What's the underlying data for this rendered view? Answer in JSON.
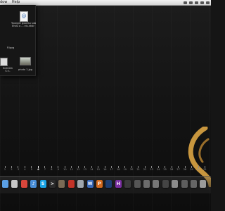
{
  "menubar": {
    "menus": [
      "dow",
      "Help"
    ],
    "status_icons": [
      "wifi-icon",
      "volume-icon",
      "battery-icon",
      "clock-icon",
      "search-icon"
    ]
  },
  "finder": {
    "items": [
      {
        "label_line1": "Younger gooesu sub",
        "label_line2": "Ehdu o ... eis.ntstr",
        "icon": "document-icon"
      },
      {
        "label": "Flipvg",
        "icon": "photo-icon"
      },
      {
        "label_line1": "ScenIdn",
        "label_line2": "S: t-",
        "icon": "photo-icon"
      },
      {
        "label": "photo 1.jpg",
        "icon": "photo-icon"
      }
    ]
  },
  "calendar_strip": {
    "days": [
      "1",
      "2",
      "3",
      "4",
      "5",
      "6",
      "7",
      "8",
      "9",
      "10",
      "11",
      "12",
      "13",
      "14",
      "15",
      "16",
      "17",
      "18",
      "19",
      "20",
      "21",
      "22",
      "23",
      "24",
      "25",
      "26",
      "27",
      "28",
      "29",
      "30",
      "31"
    ],
    "today": "6"
  },
  "dock": {
    "apps": [
      {
        "name": "finder-icon",
        "color": "#5aa0e6",
        "glyph": ""
      },
      {
        "name": "mail-icon",
        "color": "#c7c7c7",
        "glyph": ""
      },
      {
        "name": "calendar-icon",
        "color": "#d9463b",
        "glyph": ""
      },
      {
        "name": "itunes-icon",
        "color": "#4a8fd8",
        "glyph": "♪"
      },
      {
        "name": "skype-icon",
        "color": "#1aa5e6",
        "glyph": "S"
      },
      {
        "name": "terminal-icon",
        "color": "#2b2b2b",
        "glyph": ">"
      },
      {
        "name": "dictionary-icon",
        "color": "#7a6a55",
        "glyph": ""
      },
      {
        "name": "red-app-icon",
        "color": "#c23328",
        "glyph": ""
      },
      {
        "name": "preview-icon",
        "color": "#9fa6ad",
        "glyph": ""
      },
      {
        "name": "word-icon",
        "color": "#3969b8",
        "glyph": "W"
      },
      {
        "name": "powerpoint-icon",
        "color": "#d2691e",
        "glyph": "P"
      },
      {
        "name": "photoshop-icon",
        "color": "#1d3e73",
        "glyph": ""
      },
      {
        "name": "h-app-icon",
        "color": "#7a2fa1",
        "glyph": "H"
      },
      {
        "name": "monitor-icon",
        "color": "#3a3a3a",
        "glyph": ""
      },
      {
        "name": "network-icon",
        "color": "#555",
        "glyph": ""
      },
      {
        "name": "utility-icon",
        "color": "#6b6b6b",
        "glyph": ""
      },
      {
        "name": "gear-icon",
        "color": "#777",
        "glyph": ""
      },
      {
        "name": "app-a-icon",
        "color": "#444",
        "glyph": ""
      },
      {
        "name": "app-b-icon",
        "color": "#8c8c8c",
        "glyph": ""
      },
      {
        "name": "app-c-icon",
        "color": "#5d5d5d",
        "glyph": ""
      },
      {
        "name": "downloads-icon",
        "color": "#666",
        "glyph": ""
      },
      {
        "name": "trash-icon",
        "color": "#9a9a9a",
        "glyph": ""
      }
    ]
  }
}
